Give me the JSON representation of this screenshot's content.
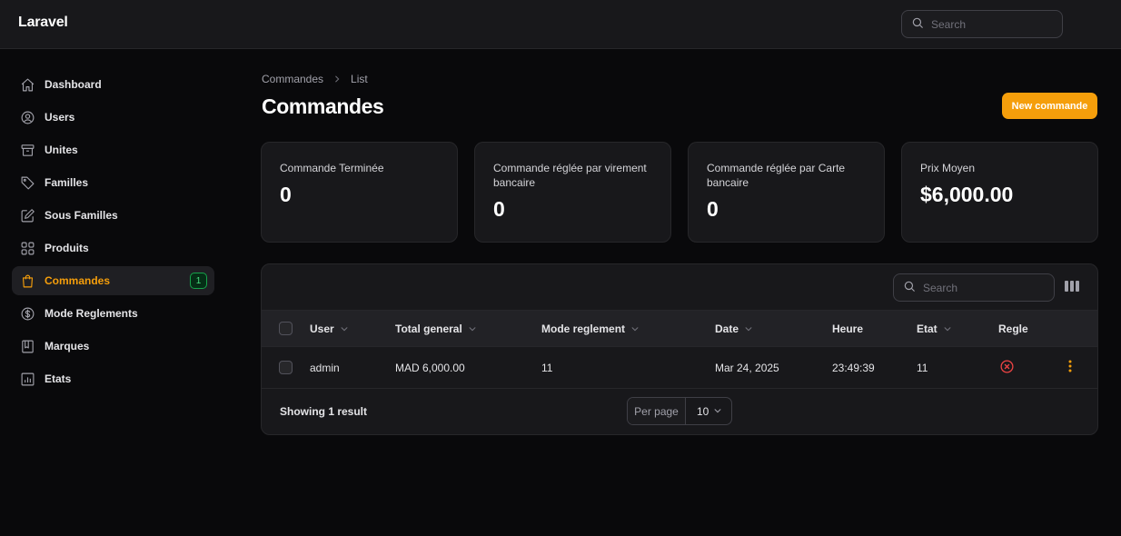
{
  "app": {
    "brand": "Laravel"
  },
  "topbar": {
    "search_placeholder": "Search"
  },
  "sidebar": {
    "items": [
      {
        "label": "Dashboard",
        "icon": "home-icon"
      },
      {
        "label": "Users",
        "icon": "user-circle-icon"
      },
      {
        "label": "Unites",
        "icon": "archive-box-icon"
      },
      {
        "label": "Familles",
        "icon": "tag-icon"
      },
      {
        "label": "Sous Familles",
        "icon": "pencil-square-icon"
      },
      {
        "label": "Produits",
        "icon": "squares-icon"
      },
      {
        "label": "Commandes",
        "icon": "shopping-bag-icon",
        "active": true,
        "badge": "1"
      },
      {
        "label": "Mode Reglements",
        "icon": "dollar-circle-icon"
      },
      {
        "label": "Marques",
        "icon": "book-icon"
      },
      {
        "label": "Etats",
        "icon": "chart-icon"
      }
    ]
  },
  "breadcrumb": {
    "parent": "Commandes",
    "current": "List"
  },
  "page": {
    "title": "Commandes",
    "new_button": "New commande"
  },
  "stats": [
    {
      "label": "Commande Terminée",
      "value": "0"
    },
    {
      "label": "Commande réglée par virement bancaire",
      "value": "0"
    },
    {
      "label": "Commande réglée par Carte bancaire",
      "value": "0"
    },
    {
      "label": "Prix Moyen",
      "value": "$6,000.00"
    }
  ],
  "table": {
    "search_placeholder": "Search",
    "columns": [
      "User",
      "Total general",
      "Mode reglement",
      "Date",
      "Heure",
      "Etat",
      "Regle"
    ],
    "rows": [
      {
        "user": "admin",
        "total": "MAD 6,000.00",
        "mode": "11",
        "date": "Mar 24, 2025",
        "heure": "23:49:39",
        "etat": "11",
        "regle": "x-circle-icon"
      }
    ],
    "showing": "Showing 1 result",
    "per_page_label": "Per page",
    "per_page_value": "10"
  },
  "colors": {
    "accent": "#f59e0b",
    "danger": "#ef4444",
    "badge": "#4ade80"
  }
}
